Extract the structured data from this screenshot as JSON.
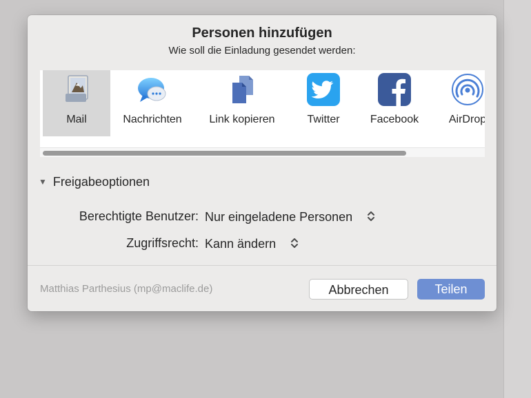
{
  "dialog": {
    "title": "Personen hinzufügen",
    "subtitle": "Wie soll die Einladung gesendet werden:"
  },
  "share_methods": [
    {
      "label": "Mail",
      "icon": "mail-icon",
      "selected": true
    },
    {
      "label": "Nachrichten",
      "icon": "messages-icon",
      "selected": false
    },
    {
      "label": "Link kopieren",
      "icon": "copy-link-icon",
      "selected": false
    },
    {
      "label": "Twitter",
      "icon": "twitter-icon",
      "selected": false
    },
    {
      "label": "Facebook",
      "icon": "facebook-icon",
      "selected": false
    },
    {
      "label": "AirDrop",
      "icon": "airdrop-icon",
      "selected": false
    }
  ],
  "options": {
    "section_label": "Freigabeoptionen",
    "permitted_users_label": "Berechtigte Benutzer:",
    "permitted_users_value": "Nur eingeladene Personen",
    "access_label": "Zugriffsrecht:",
    "access_value": "Kann ändern"
  },
  "footer": {
    "user": "Matthias Parthesius (mp@maclife.de)",
    "cancel_label": "Abbrechen",
    "share_label": "Teilen"
  },
  "colors": {
    "primary_button": "#6e8fd3",
    "twitter": "#2aa3ef",
    "facebook": "#3b5a9a",
    "airdrop": "#4a7fd6"
  }
}
